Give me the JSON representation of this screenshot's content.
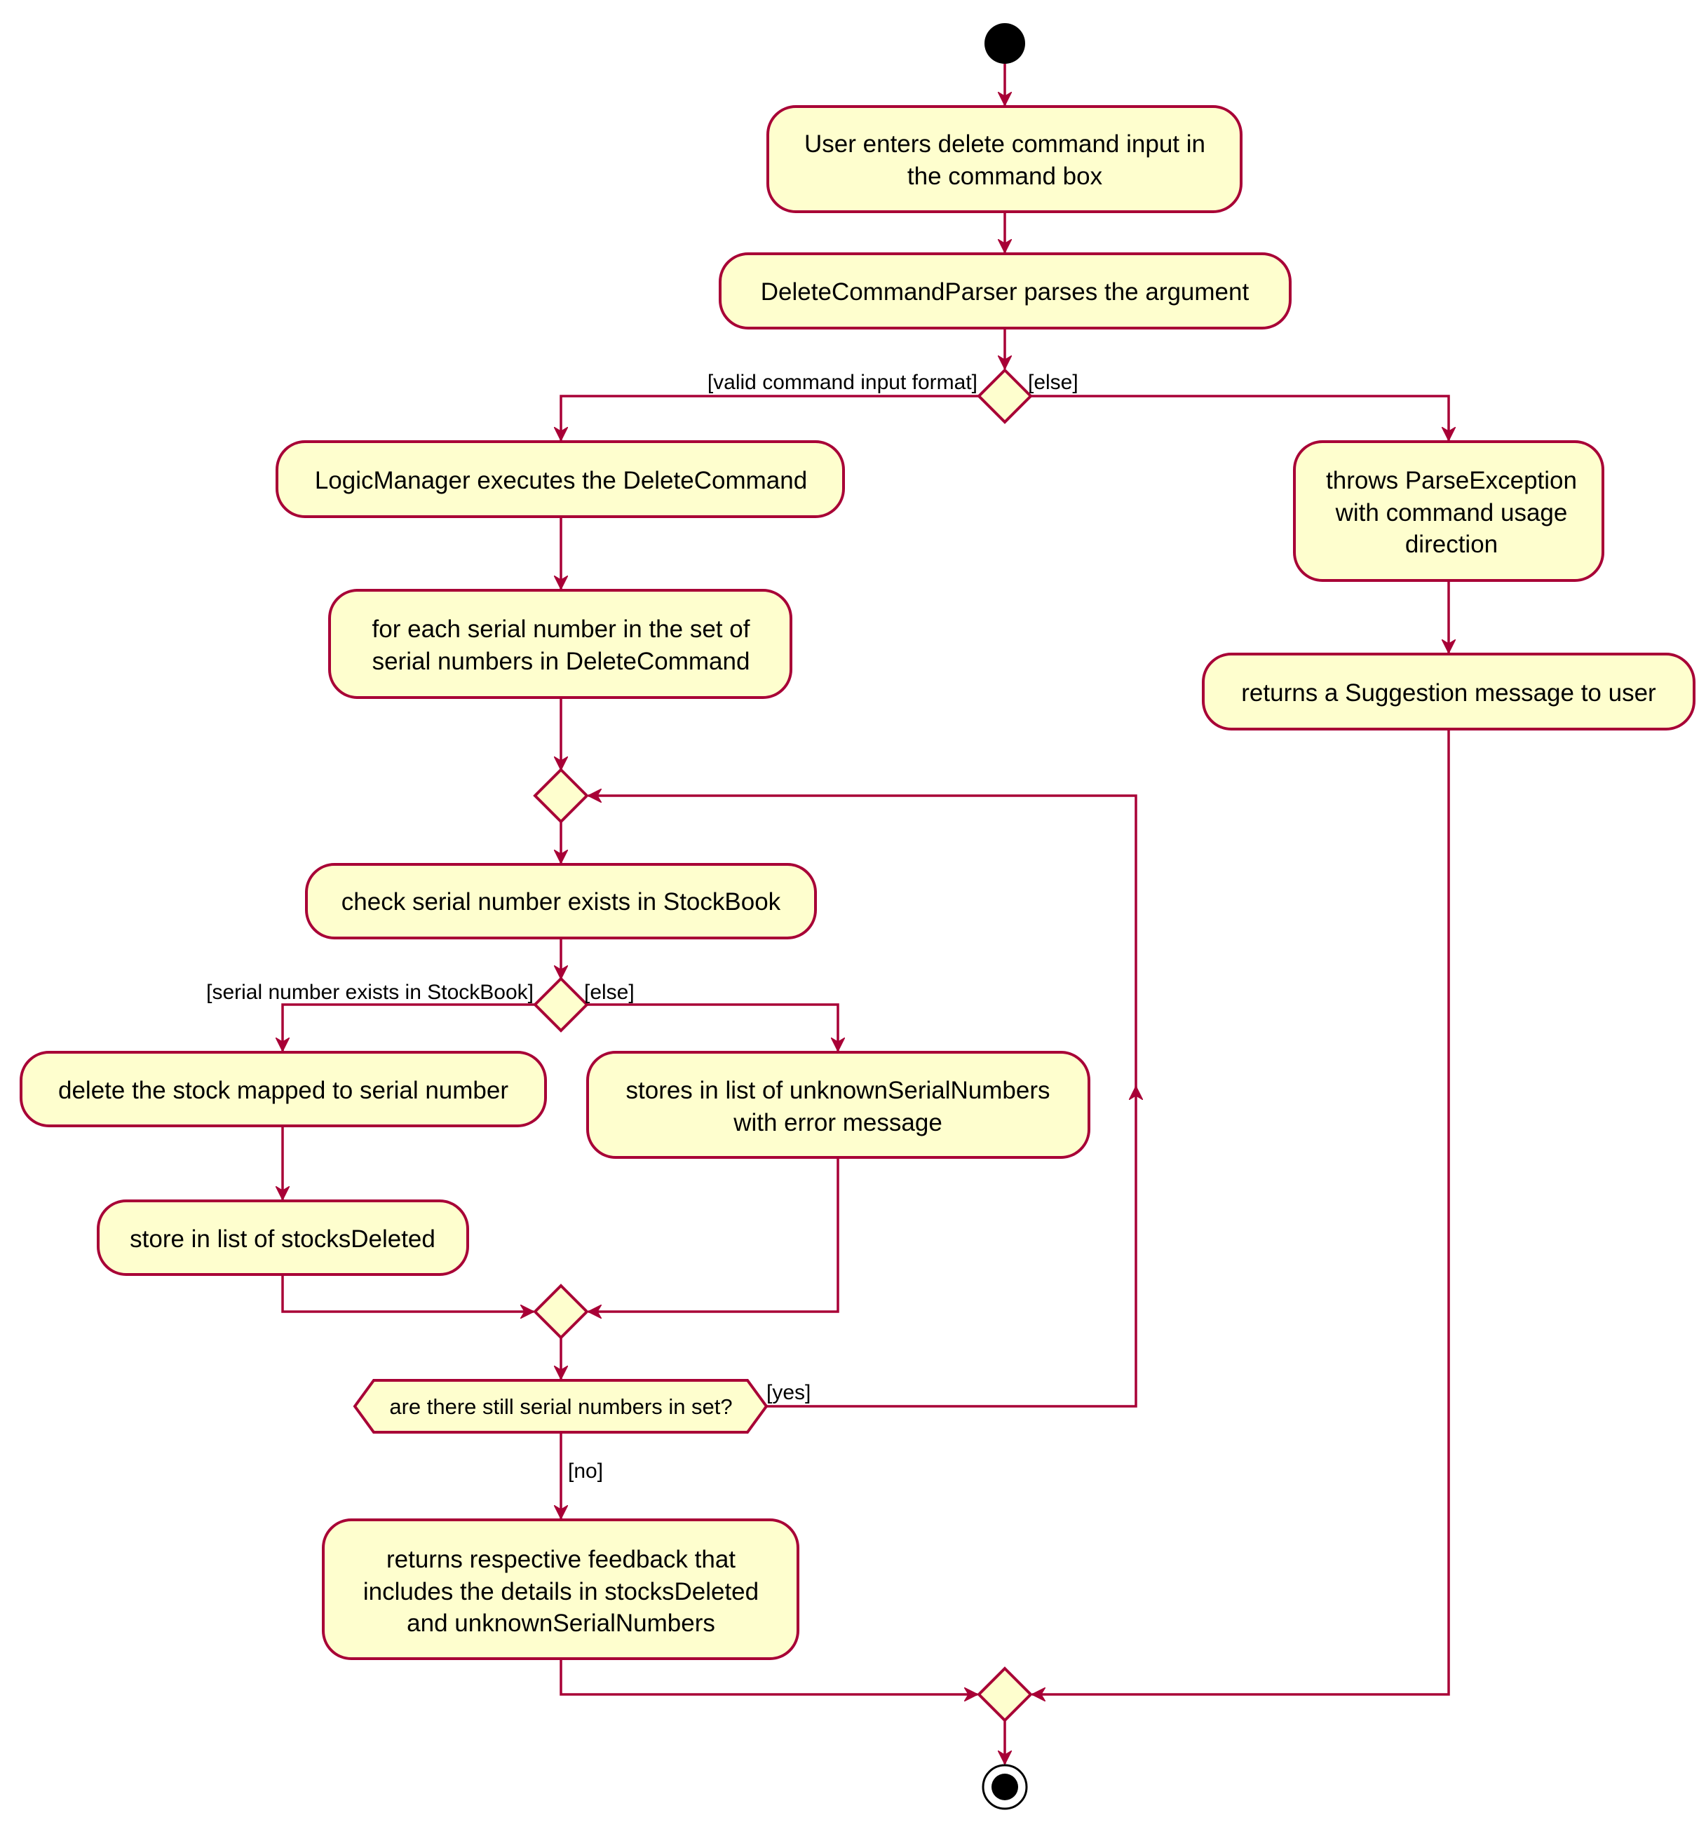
{
  "diagram": {
    "type": "uml-activity-diagram",
    "colors": {
      "border": "#A80036",
      "fill": "#FEFECE",
      "text": "#000000",
      "start": "#000000",
      "background": "#FFFFFF"
    },
    "activities": {
      "user_enters": [
        "User enters delete command input in",
        "the command box"
      ],
      "parser": [
        "DeleteCommandParser parses the argument"
      ],
      "logic_manager": [
        "LogicManager executes the DeleteCommand"
      ],
      "for_each": [
        "for each serial number in the set of",
        "serial numbers in DeleteCommand"
      ],
      "check_exists": [
        "check serial number exists in StockBook"
      ],
      "delete_stock": [
        "delete the stock mapped to serial number"
      ],
      "store_unknown": [
        "stores in list of unknownSerialNumbers",
        "with error message"
      ],
      "store_deleted": [
        "store in list of stocksDeleted"
      ],
      "feedback": [
        "returns respective feedback that",
        "includes the details in stocksDeleted",
        "and unknownSerialNumbers"
      ],
      "throws": [
        "throws ParseException",
        "with command usage",
        "direction"
      ],
      "suggestion": [
        "returns a Suggestion message to user"
      ]
    },
    "decisions": {
      "valid_format": {
        "yes": "[valid command input format]",
        "no": "[else]"
      },
      "exists": {
        "yes": "[serial number exists in StockBook]",
        "no": "[else]"
      },
      "more": {
        "question": "are there still serial numbers in set?",
        "yes": "[yes]",
        "no": "[no]"
      }
    }
  }
}
